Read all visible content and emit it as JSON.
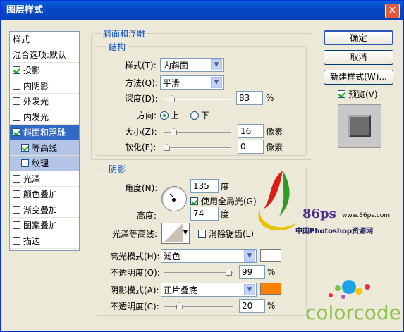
{
  "window": {
    "title": "图层样式",
    "close": "✕"
  },
  "sidebar": {
    "header": "样式",
    "blend": "混合选项:默认",
    "items": [
      {
        "label": "投影",
        "checked": true
      },
      {
        "label": "内阴影",
        "checked": false
      },
      {
        "label": "外发光",
        "checked": false
      },
      {
        "label": "内发光",
        "checked": false
      },
      {
        "label": "斜面和浮雕",
        "checked": true,
        "selected": true
      },
      {
        "label": "等高线",
        "checked": true,
        "sub": true
      },
      {
        "label": "纹理",
        "checked": false,
        "sub": true
      },
      {
        "label": "光泽",
        "checked": false
      },
      {
        "label": "颜色叠加",
        "checked": false
      },
      {
        "label": "渐变叠加",
        "checked": false
      },
      {
        "label": "图案叠加",
        "checked": false
      },
      {
        "label": "描边",
        "checked": false
      }
    ]
  },
  "bevel": {
    "title": "斜面和浮雕",
    "structure": "结构",
    "style_label": "样式(T):",
    "style_value": "内斜面",
    "method_label": "方法(Q):",
    "method_value": "平滑",
    "depth_label": "深度(D):",
    "depth_value": "83",
    "depth_unit": "%",
    "depth_level": 0.08,
    "direction_label": "方向:",
    "dir_up": "上",
    "dir_down": "下",
    "size_label": "大小(Z):",
    "size_value": "16",
    "size_unit": "像素",
    "size_level": 0.12,
    "soften_label": "软化(F):",
    "soften_value": "0",
    "soften_unit": "像素",
    "soften_level": 0
  },
  "shading": {
    "title": "阴影",
    "angle_label": "角度(N):",
    "angle_value": "135",
    "angle_unit": "度",
    "global_light": "使用全局光(G)",
    "global_checked": true,
    "altitude_label": "高度:",
    "altitude_value": "74",
    "altitude_unit": "度",
    "gloss_label": "光泽等高线:",
    "antialias": "消除锯齿(L)",
    "highlight_label": "高光模式(H):",
    "highlight_value": "滤色",
    "highlight_color": "#ffffff",
    "hopacity_label": "不透明度(O):",
    "hopacity_value": "99",
    "hopacity_unit": "%",
    "hopacity_level": 0.99,
    "shadow_label": "阴影模式(A):",
    "shadow_value": "正片叠底",
    "shadow_color": "#ff8000",
    "sopacity_label": "不透明度(C):",
    "sopacity_value": "20",
    "sopacity_unit": "%",
    "sopacity_level": 0.2
  },
  "buttons": {
    "ok": "确定",
    "cancel": "取消",
    "new_style": "新建样式(W)...",
    "preview": "预览(V)",
    "preview_checked": true
  },
  "watermark": {
    "site_num": "86ps",
    "site_url": "www.86ps.com",
    "site_cn": "中国Photoshop资源网",
    "brand": "colorcode"
  }
}
